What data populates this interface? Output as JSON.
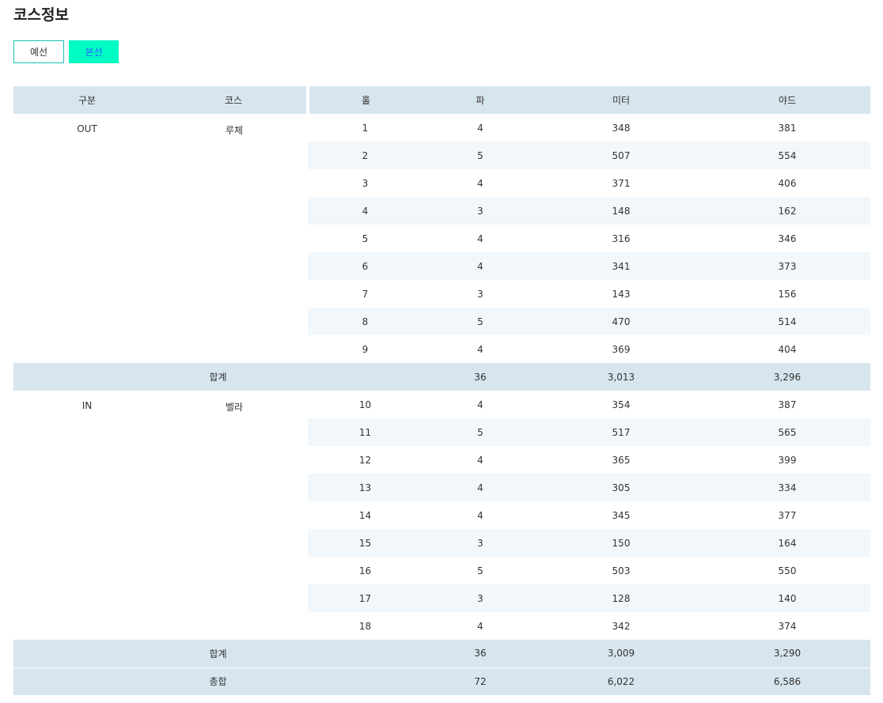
{
  "page_title": "코스정보",
  "tabs": [
    {
      "label": "예선",
      "active": false
    },
    {
      "label": "본선",
      "active": true
    }
  ],
  "colors": {
    "header_bg": "#d7e5ee",
    "alt_row_bg": "#f1f7fa",
    "active_tab_bg": "#00fdc4",
    "active_tab_text": "#2b5bff",
    "inactive_tab_border": "#1bc4b4"
  },
  "table": {
    "headers": [
      "구분",
      "코스",
      "홀",
      "파",
      "미터",
      "야드"
    ],
    "sections": [
      {
        "division": "OUT",
        "course": "루체",
        "holes": [
          {
            "hole": "1",
            "par": "4",
            "meter": "348",
            "yard": "381"
          },
          {
            "hole": "2",
            "par": "5",
            "meter": "507",
            "yard": "554"
          },
          {
            "hole": "3",
            "par": "4",
            "meter": "371",
            "yard": "406"
          },
          {
            "hole": "4",
            "par": "3",
            "meter": "148",
            "yard": "162"
          },
          {
            "hole": "5",
            "par": "4",
            "meter": "316",
            "yard": "346"
          },
          {
            "hole": "6",
            "par": "4",
            "meter": "341",
            "yard": "373"
          },
          {
            "hole": "7",
            "par": "3",
            "meter": "143",
            "yard": "156"
          },
          {
            "hole": "8",
            "par": "5",
            "meter": "470",
            "yard": "514"
          },
          {
            "hole": "9",
            "par": "4",
            "meter": "369",
            "yard": "404"
          }
        ],
        "subtotal": {
          "label": "합계",
          "par": "36",
          "meter": "3,013",
          "yard": "3,296"
        }
      },
      {
        "division": "IN",
        "course": "벨라",
        "holes": [
          {
            "hole": "10",
            "par": "4",
            "meter": "354",
            "yard": "387"
          },
          {
            "hole": "11",
            "par": "5",
            "meter": "517",
            "yard": "565"
          },
          {
            "hole": "12",
            "par": "4",
            "meter": "365",
            "yard": "399"
          },
          {
            "hole": "13",
            "par": "4",
            "meter": "305",
            "yard": "334"
          },
          {
            "hole": "14",
            "par": "4",
            "meter": "345",
            "yard": "377"
          },
          {
            "hole": "15",
            "par": "3",
            "meter": "150",
            "yard": "164"
          },
          {
            "hole": "16",
            "par": "5",
            "meter": "503",
            "yard": "550"
          },
          {
            "hole": "17",
            "par": "3",
            "meter": "128",
            "yard": "140"
          },
          {
            "hole": "18",
            "par": "4",
            "meter": "342",
            "yard": "374"
          }
        ],
        "subtotal": {
          "label": "합계",
          "par": "36",
          "meter": "3,009",
          "yard": "3,290"
        }
      }
    ],
    "total": {
      "label": "총합",
      "par": "72",
      "meter": "6,022",
      "yard": "6,586"
    }
  }
}
